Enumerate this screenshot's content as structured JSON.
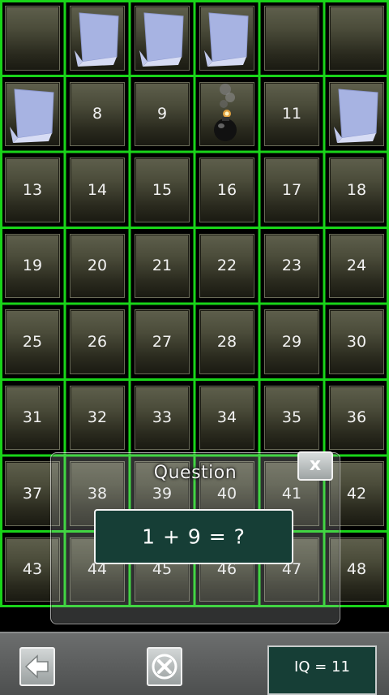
{
  "board": {
    "columns": 6,
    "rows": 8,
    "cells": [
      {
        "type": "blank"
      },
      {
        "type": "cube"
      },
      {
        "type": "cube"
      },
      {
        "type": "cube"
      },
      {
        "type": "blank"
      },
      {
        "type": "blank"
      },
      {
        "type": "cube"
      },
      {
        "type": "number",
        "label": "8"
      },
      {
        "type": "number",
        "label": "9"
      },
      {
        "type": "bomb"
      },
      {
        "type": "number",
        "label": "11"
      },
      {
        "type": "cube"
      },
      {
        "type": "number",
        "label": "13"
      },
      {
        "type": "number",
        "label": "14"
      },
      {
        "type": "number",
        "label": "15"
      },
      {
        "type": "number",
        "label": "16"
      },
      {
        "type": "number",
        "label": "17"
      },
      {
        "type": "number",
        "label": "18"
      },
      {
        "type": "number",
        "label": "19"
      },
      {
        "type": "number",
        "label": "20"
      },
      {
        "type": "number",
        "label": "21"
      },
      {
        "type": "number",
        "label": "22"
      },
      {
        "type": "number",
        "label": "23"
      },
      {
        "type": "number",
        "label": "24"
      },
      {
        "type": "number",
        "label": "25"
      },
      {
        "type": "number",
        "label": "26"
      },
      {
        "type": "number",
        "label": "27"
      },
      {
        "type": "number",
        "label": "28"
      },
      {
        "type": "number",
        "label": "29"
      },
      {
        "type": "number",
        "label": "30"
      },
      {
        "type": "number",
        "label": "31"
      },
      {
        "type": "number",
        "label": "32"
      },
      {
        "type": "number",
        "label": "33"
      },
      {
        "type": "number",
        "label": "34"
      },
      {
        "type": "number",
        "label": "35"
      },
      {
        "type": "number",
        "label": "36"
      },
      {
        "type": "number",
        "label": "37"
      },
      {
        "type": "number",
        "label": "38"
      },
      {
        "type": "number",
        "label": "39"
      },
      {
        "type": "number",
        "label": "40"
      },
      {
        "type": "number",
        "label": "41"
      },
      {
        "type": "number",
        "label": "42"
      },
      {
        "type": "number",
        "label": "43"
      },
      {
        "type": "number",
        "label": "44"
      },
      {
        "type": "number",
        "label": "45"
      },
      {
        "type": "number",
        "label": "46"
      },
      {
        "type": "number",
        "label": "47"
      },
      {
        "type": "number",
        "label": "48"
      }
    ]
  },
  "dialog": {
    "title": "Question",
    "question": "1 + 9 = ?",
    "close_label": "x"
  },
  "bottom_bar": {
    "back_icon": "back-arrow-icon",
    "cancel_icon": "close-x-icon",
    "iq_text": "IQ = 11"
  },
  "colors": {
    "grid_line": "#19d419",
    "tile_top": "#5e5f4c",
    "tile_bottom": "#1a1a12",
    "question_box": "#163e36",
    "cube_face": "#a9b5e3"
  }
}
